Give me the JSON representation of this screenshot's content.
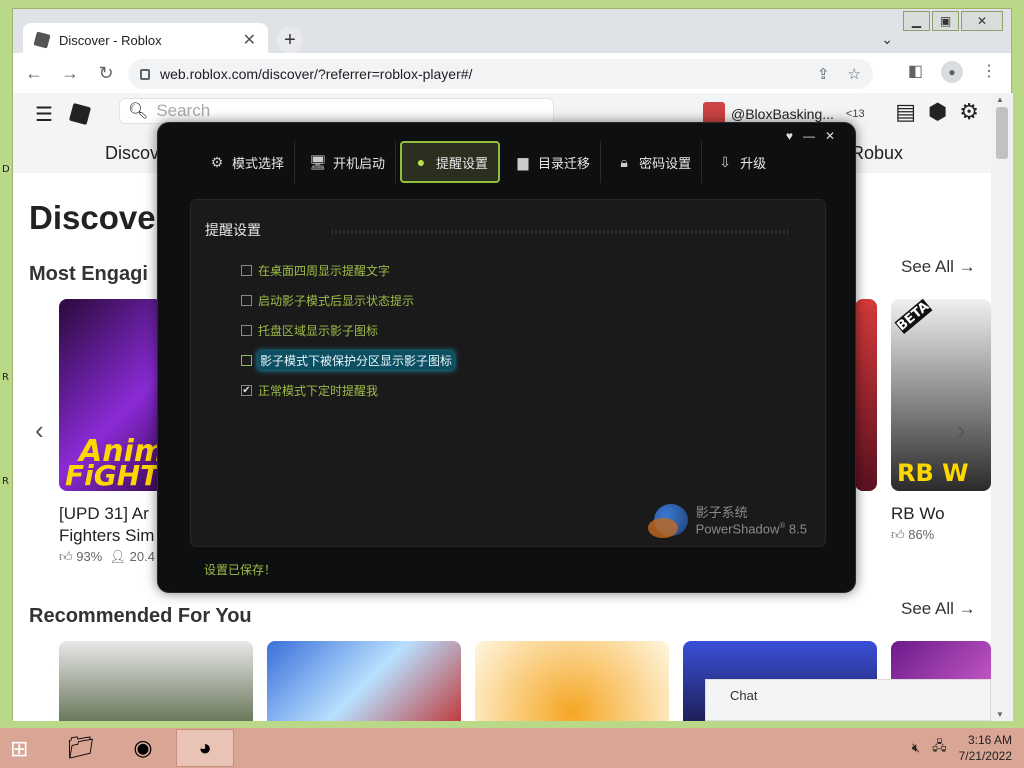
{
  "browser": {
    "tab_title": "Discover - Roblox",
    "url": "web.roblox.com/discover/?referrer=roblox-player#/"
  },
  "roblox": {
    "search_placeholder": "Search",
    "username": "@BloxBasking...",
    "age_label": "<13",
    "subnav": [
      "Discov",
      "Robux"
    ],
    "page_title": "Discove",
    "section1": "Most Engagi",
    "section2": "Recommended For You",
    "see_all": "See All →",
    "games": [
      {
        "title_line1": "[UPD 31] Ar",
        "title_line2": "Fighters Sim",
        "rating": "93%",
        "players": "20.4"
      },
      {
        "title_line1": "RB Wo",
        "title_line2": "",
        "rating": "86%",
        "players": ""
      }
    ],
    "card_text": {
      "anime_top": "Anim",
      "anime_bot": "FiGHT",
      "rb": "RB W",
      "beta": "BETA"
    },
    "chat_label": "Chat"
  },
  "dialog": {
    "tabs": [
      {
        "label": "模式选择",
        "icon": "gear-icon"
      },
      {
        "label": "开机启动",
        "icon": "monitor-icon"
      },
      {
        "label": "提醒设置",
        "icon": "bulb-icon"
      },
      {
        "label": "目录迁移",
        "icon": "folder-icon"
      },
      {
        "label": "密码设置",
        "icon": "lock-icon"
      },
      {
        "label": "升级",
        "icon": "upgrade-icon"
      }
    ],
    "active_tab": "提醒设置",
    "panel_title": "提醒设置",
    "options": [
      {
        "label": "在桌面四周显示提醒文字",
        "checked": false
      },
      {
        "label": "启动影子模式后显示状态提示",
        "checked": false
      },
      {
        "label": "托盘区域显示影子图标",
        "checked": false
      },
      {
        "label": "影子模式下被保护分区显示影子图标",
        "checked": false
      },
      {
        "label": "正常模式下定时提醒我",
        "checked": true
      }
    ],
    "brand_cn": "影子系统",
    "brand_en": "PowerShadow",
    "version": "8.5",
    "status": "设置已保存！",
    "accent_color": "#9dbb47"
  },
  "taskbar": {
    "time": "3:16 AM",
    "date": "7/21/2022"
  }
}
